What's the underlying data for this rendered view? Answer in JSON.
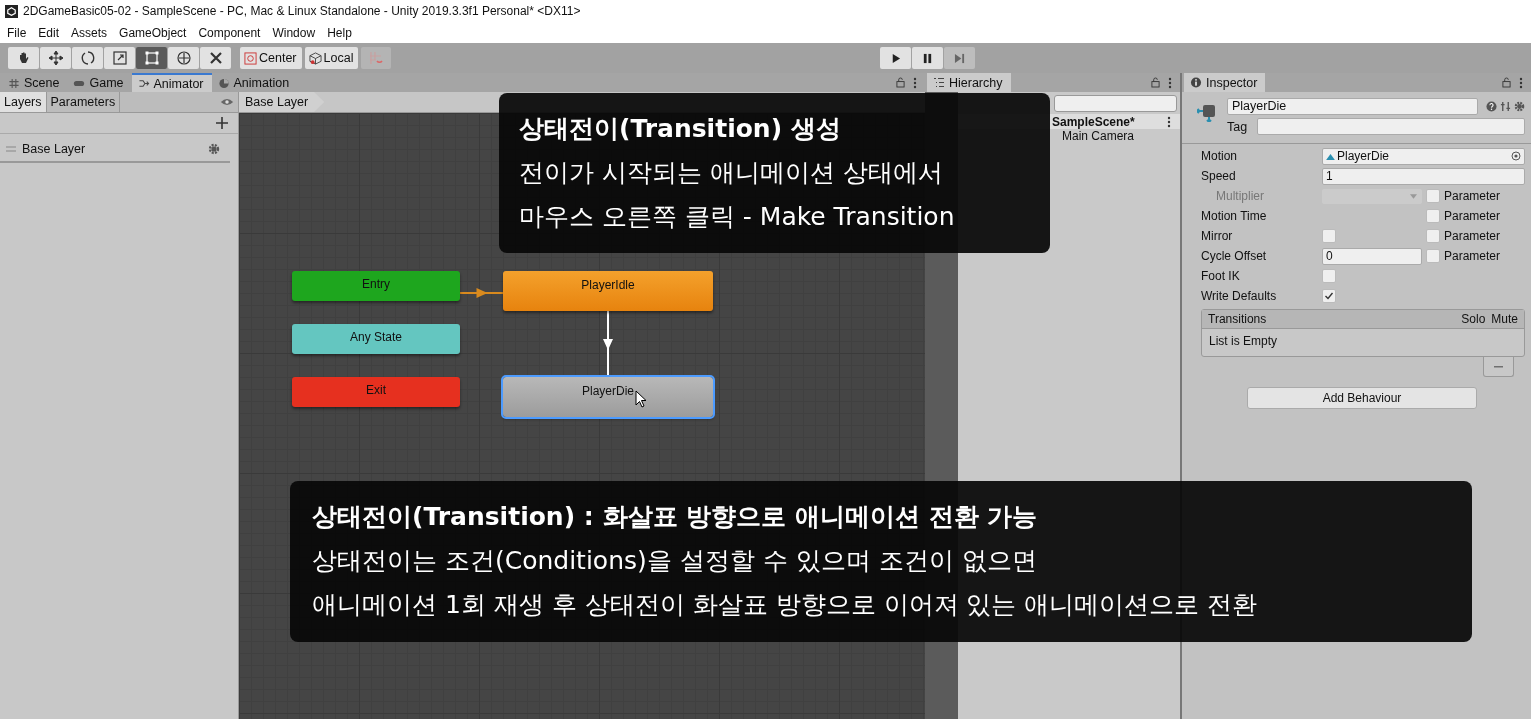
{
  "window": {
    "title": "2DGameBasic05-02 - SampleScene - PC, Mac & Linux Standalone - Unity 2019.3.3f1 Personal* <DX11>"
  },
  "menu": [
    "File",
    "Edit",
    "Assets",
    "GameObject",
    "Component",
    "Window",
    "Help"
  ],
  "toolbar": {
    "tools": [
      {
        "kind": "hand",
        "selected": false
      },
      {
        "kind": "move",
        "selected": false
      },
      {
        "kind": "rotate",
        "selected": false
      },
      {
        "kind": "scale",
        "selected": false
      },
      {
        "kind": "rect",
        "selected": true
      },
      {
        "kind": "transform",
        "selected": false
      },
      {
        "kind": "custom",
        "selected": false
      }
    ],
    "pivot": [
      {
        "kind": "center",
        "label": "Center"
      },
      {
        "kind": "local",
        "label": "Local"
      }
    ]
  },
  "tabs": [
    {
      "kind": "scene",
      "label": "Scene",
      "selected": false
    },
    {
      "kind": "game",
      "label": "Game",
      "selected": false
    },
    {
      "kind": "animator",
      "label": "Animator",
      "selected": true
    },
    {
      "kind": "animation",
      "label": "Animation",
      "selected": false
    }
  ],
  "animator": {
    "subtabs": [
      {
        "label": "Layers",
        "selected": true
      },
      {
        "label": "Parameters",
        "selected": false
      }
    ],
    "layers": [
      {
        "name": "Base Layer"
      }
    ],
    "breadcrumb": "Base Layer",
    "states": [
      {
        "name": "Entry",
        "kind": "entry",
        "selected": false
      },
      {
        "name": "PlayerIdle",
        "kind": "default",
        "selected": false
      },
      {
        "name": "Any State",
        "kind": "any",
        "selected": false
      },
      {
        "name": "Exit",
        "kind": "exit",
        "selected": false
      },
      {
        "name": "PlayerDie",
        "kind": "normal",
        "selected": true
      }
    ],
    "transitions": [
      {
        "kind": "entry"
      },
      {
        "kind": "state"
      }
    ]
  },
  "hierarchy": {
    "title": "Hierarchy",
    "items": [
      {
        "name": "SampleScene*",
        "children": [
          {
            "name": "Main Camera"
          }
        ]
      }
    ]
  },
  "inspector": {
    "title": "Inspector",
    "name": "PlayerDie",
    "tag_label": "Tag",
    "fields": [
      {
        "label": "Motion",
        "kind": "object",
        "value": "PlayerDie",
        "disabled": false
      },
      {
        "label": "Speed",
        "kind": "text",
        "value": "1",
        "disabled": false
      },
      {
        "label": "Multiplier",
        "kind": "dropdown",
        "disabled": true,
        "parameter": {
          "label": "Parameter",
          "checked": false
        }
      },
      {
        "label": "Motion Time",
        "kind": "none",
        "disabled": false,
        "parameter": {
          "label": "Parameter",
          "checked": false
        }
      },
      {
        "label": "Mirror",
        "kind": "checkbox",
        "checked": false,
        "disabled": false,
        "parameter": {
          "label": "Parameter",
          "checked": false
        }
      },
      {
        "label": "Cycle Offset",
        "kind": "text",
        "value": "0",
        "disabled": false,
        "parameter": {
          "label": "Parameter",
          "checked": false
        }
      },
      {
        "label": "Foot IK",
        "kind": "checkbox",
        "checked": false,
        "disabled": false
      },
      {
        "label": "Write Defaults",
        "kind": "checkbox",
        "checked": true,
        "disabled": false
      }
    ],
    "transitions": {
      "columns": [
        "Transitions",
        "Solo",
        "Mute"
      ],
      "empty": "List is Empty"
    },
    "add_button": "Add Behaviour"
  },
  "captions": [
    {
      "kind": "top",
      "title": "상태전이(Transition) 생성",
      "lines": [
        "전이가 시작되는 애니메이션 상태에서",
        "마우스 오른쪽 클릭 - Make Transition"
      ]
    },
    {
      "kind": "bottom",
      "title": "상태전이(Transition) : 화살표 방향으로 애니메이션 전환 가능",
      "lines": [
        "상태전이는 조건(Conditions)을 설정할 수 있으며 조건이 없으면",
        "애니메이션 1회 재생 후 상태전이 화살표 방향으로 이어져 있는 애니메이션으로 전환"
      ]
    }
  ]
}
